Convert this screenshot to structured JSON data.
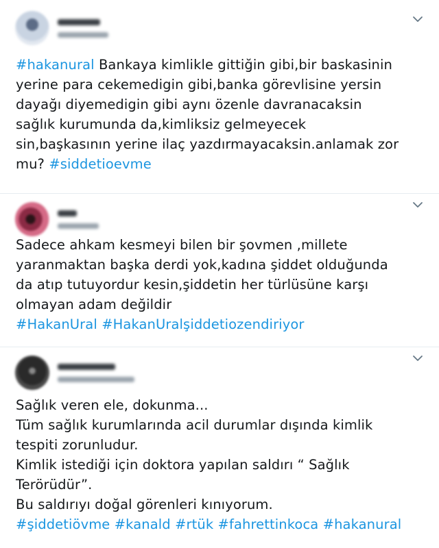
{
  "tweets": [
    {
      "lines": [
        [
          {
            "t": "#hakanural",
            "tag": true
          },
          {
            "t": " Bankaya kimlikle gittiğin gibi,bir baskasinin",
            "tag": false
          }
        ],
        [
          {
            "t": "yerine para cekemedigin gibi,banka görevlisine yersin",
            "tag": false
          }
        ],
        [
          {
            "t": "dayağı diyemedigin gibi aynı özenle davranacaksin",
            "tag": false
          }
        ],
        [
          {
            "t": "sağlık kurumunda da,kimliksiz gelmeyecek",
            "tag": false
          }
        ],
        [
          {
            "t": "sin,başkasının yerine ilaç yazdırmayacaksin.anlamak zor",
            "tag": false
          }
        ],
        [
          {
            "t": "mu? ",
            "tag": false
          },
          {
            "t": "#siddetioevme",
            "tag": true
          }
        ]
      ]
    },
    {
      "lines": [
        [
          {
            "t": "Sadece ahkam kesmeyi bilen bir şovmen ,millete",
            "tag": false
          }
        ],
        [
          {
            "t": "yaranmaktan başka derdi yok,kadına şiddet olduğunda",
            "tag": false
          }
        ],
        [
          {
            "t": "da atıp tutuyordur kesin,şiddetin her türlüsüne karşı",
            "tag": false
          }
        ],
        [
          {
            "t": "olmayan adam değildir",
            "tag": false
          }
        ],
        [
          {
            "t": "#HakanUral",
            "tag": true
          },
          {
            "t": " ",
            "tag": false
          },
          {
            "t": "#HakanUralşiddetiozendiriyor",
            "tag": true
          }
        ]
      ]
    },
    {
      "lines": [
        [
          {
            "t": "Sağlık veren ele,  dokunma...",
            "tag": false
          }
        ],
        [
          {
            "t": "Tüm sağlık kurumlarında acil durumlar dışında kimlik",
            "tag": false
          }
        ],
        [
          {
            "t": "tespiti zorunludur.",
            "tag": false
          }
        ],
        [
          {
            "t": "Kimlik istediği için doktora yapılan saldırı “ Sağlık",
            "tag": false
          }
        ],
        [
          {
            "t": "Terörüdür”.",
            "tag": false
          }
        ],
        [
          {
            "t": "Bu saldırıyı doğal görenleri kınıyorum.",
            "tag": false
          }
        ],
        [
          {
            "t": "#şiddetiövme",
            "tag": true
          },
          {
            "t": " ",
            "tag": false
          },
          {
            "t": "#kanald",
            "tag": true
          },
          {
            "t": " ",
            "tag": false
          },
          {
            "t": "#rtük",
            "tag": true
          },
          {
            "t": " ",
            "tag": false
          },
          {
            "t": "#fahrettinkoca",
            "tag": true
          },
          {
            "t": " ",
            "tag": false
          },
          {
            "t": "#hakanural",
            "tag": true
          }
        ]
      ]
    }
  ],
  "colors": {
    "hashtag": "#1b95e0",
    "text": "#14171a",
    "divider": "#e6ecf0"
  },
  "icons": {
    "menu": "chevron-down-icon",
    "avatar": "blurred-avatar"
  }
}
